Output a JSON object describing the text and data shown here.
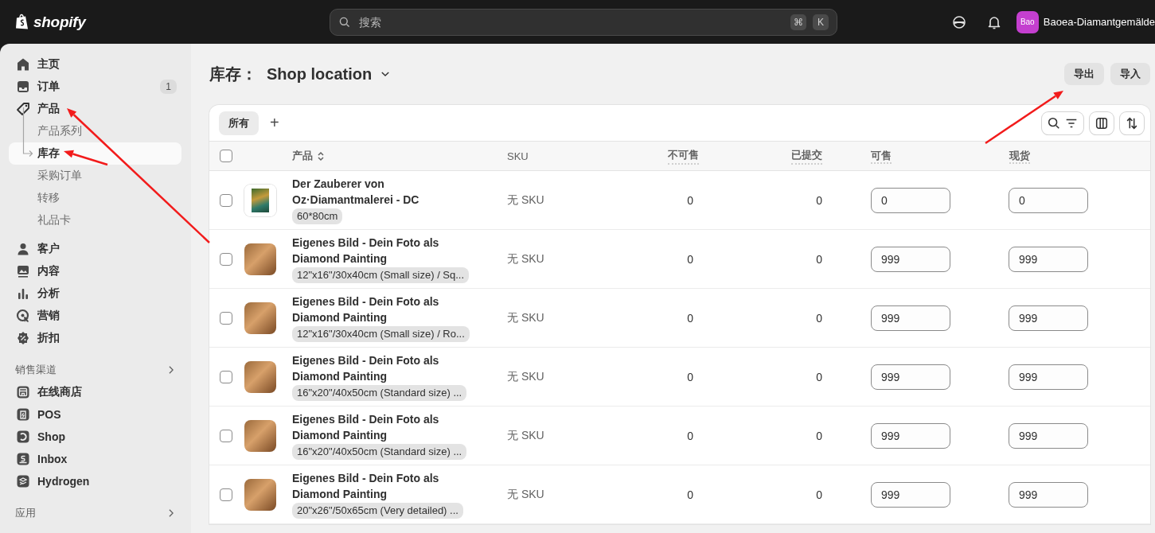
{
  "topbar": {
    "logo": "shopify",
    "search": {
      "placeholder": "搜索"
    },
    "shortcut_keys": [
      "⌘",
      "K"
    ],
    "avatar": "Bao",
    "store_name": "Baoea-Diamantgemälde"
  },
  "sidebar": {
    "items": [
      {
        "label": "主页",
        "selected": false
      },
      {
        "label": "订单",
        "badge": "1",
        "selected": false
      },
      {
        "label": "产品",
        "selected": false,
        "expanded": true,
        "children": [
          {
            "label": "产品系列",
            "selected": false
          },
          {
            "label": "库存",
            "selected": true
          },
          {
            "label": "采购订单",
            "selected": false
          },
          {
            "label": "转移",
            "selected": false
          },
          {
            "label": "礼品卡",
            "selected": false
          }
        ]
      },
      {
        "label": "客户",
        "selected": false
      },
      {
        "label": "内容",
        "selected": false
      },
      {
        "label": "分析",
        "selected": false
      },
      {
        "label": "营销",
        "selected": false
      },
      {
        "label": "折扣",
        "selected": false
      }
    ],
    "sections": [
      {
        "title": "销售渠道",
        "items": [
          {
            "label": "在线商店",
            "selected": false
          },
          {
            "label": "POS",
            "selected": false
          },
          {
            "label": "Shop",
            "selected": false
          },
          {
            "label": "Inbox",
            "selected": false
          },
          {
            "label": "Hydrogen",
            "selected": false
          }
        ]
      },
      {
        "title": "应用"
      }
    ]
  },
  "page": {
    "title": "库存：",
    "location": "Shop location",
    "actions": [
      "导出",
      "导入"
    ],
    "tabs": [
      {
        "label": "所有",
        "selected": true
      }
    ],
    "add_tab": "+",
    "table": {
      "all_selected": false,
      "columns": [
        "产品",
        "SKU",
        "不可售",
        "已提交",
        "可售",
        "现货"
      ],
      "rows": [
        {
          "checked": false,
          "kind": "painting",
          "title": "Der Zauberer von Oz·Diamantmalerei - DC",
          "variant": "60*80cm",
          "sku": "无 SKU",
          "unavailable": "0",
          "committed": "0",
          "available": "0",
          "on_hand": "0"
        },
        {
          "checked": false,
          "kind": "photo",
          "title": "Eigenes Bild - Dein Foto als Diamond Painting",
          "variant": "12\"x16\"/30x40cm (Small size) / Sq...",
          "sku": "无 SKU",
          "unavailable": "0",
          "committed": "0",
          "available": "999",
          "on_hand": "999"
        },
        {
          "checked": false,
          "kind": "photo",
          "title": "Eigenes Bild - Dein Foto als Diamond Painting",
          "variant": "12\"x16\"/30x40cm (Small size) / Ro...",
          "sku": "无 SKU",
          "unavailable": "0",
          "committed": "0",
          "available": "999",
          "on_hand": "999"
        },
        {
          "checked": false,
          "kind": "photo",
          "title": "Eigenes Bild - Dein Foto als Diamond Painting",
          "variant": "16\"x20\"/40x50cm (Standard size) ...",
          "sku": "无 SKU",
          "unavailable": "0",
          "committed": "0",
          "available": "999",
          "on_hand": "999"
        },
        {
          "checked": false,
          "kind": "photo",
          "title": "Eigenes Bild - Dein Foto als Diamond Painting",
          "variant": "16\"x20\"/40x50cm (Standard size) ...",
          "sku": "无 SKU",
          "unavailable": "0",
          "committed": "0",
          "available": "999",
          "on_hand": "999"
        },
        {
          "checked": false,
          "kind": "photo",
          "title": "Eigenes Bild - Dein Foto als Diamond Painting",
          "variant": "20\"x26\"/50x65cm (Very detailed) ...",
          "sku": "无 SKU",
          "unavailable": "0",
          "committed": "0",
          "available": "999",
          "on_hand": "999"
        }
      ]
    }
  }
}
